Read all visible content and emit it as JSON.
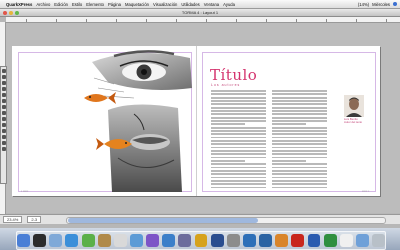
{
  "menubar": {
    "app_name": "QuarkXPress",
    "items": [
      "Archivo",
      "Edición",
      "Estilo",
      "Elemento",
      "Página",
      "Maquetación",
      "Visualización",
      "Utilidades",
      "Ventana",
      "Ayuda"
    ],
    "status_text": "(14%)",
    "clock": "Miércoles"
  },
  "window": {
    "title": "TORMA 4 : Layout 1"
  },
  "document": {
    "heading": "Título",
    "byline": "Los autores",
    "caption_line1": "Luis Benito",
    "caption_line2": "Autor del texto"
  },
  "statusbar": {
    "zoom": "23.4%",
    "page": "2-3"
  },
  "dock": {
    "apps": [
      "finder-icon",
      "dashboard-icon",
      "mail-icon",
      "safari-icon",
      "ichat-icon",
      "address-book-icon",
      "ical-icon",
      "preview-icon",
      "itunes-icon",
      "iphoto-icon",
      "imovie-icon",
      "garageband-icon",
      "quicktime-icon",
      "system-prefs-icon",
      "quark-icon",
      "photoshop-icon",
      "illustrator-icon",
      "acrobat-icon",
      "word-icon",
      "excel-icon",
      "textedit-icon",
      "folder-icon",
      "trash-icon"
    ]
  }
}
